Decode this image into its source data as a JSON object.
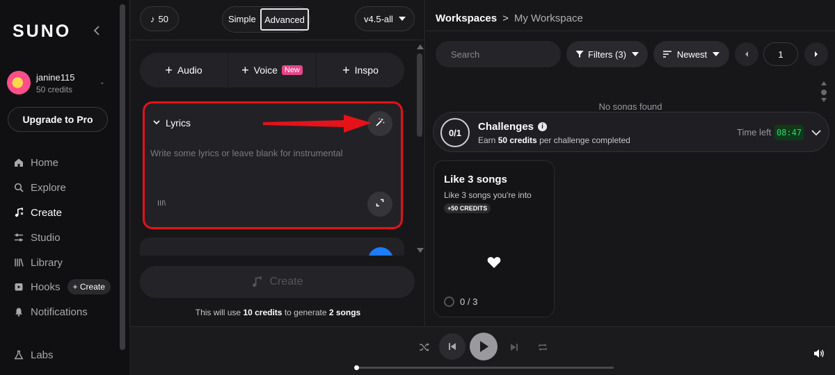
{
  "sidebar": {
    "logo": "SUNO",
    "user": {
      "name": "janine115",
      "credits": "50 credits"
    },
    "upgrade_label": "Upgrade to Pro",
    "nav": [
      {
        "label": "Home",
        "icon": "home-icon"
      },
      {
        "label": "Explore",
        "icon": "search-icon"
      },
      {
        "label": "Create",
        "icon": "music-note-icon"
      },
      {
        "label": "Studio",
        "icon": "sliders-icon"
      },
      {
        "label": "Library",
        "icon": "library-icon"
      },
      {
        "label": "Hooks",
        "icon": "hooks-icon",
        "badge": "+ Create"
      },
      {
        "label": "Notifications",
        "icon": "bell-icon"
      },
      {
        "label": "Labs",
        "icon": "flask-icon"
      }
    ]
  },
  "create": {
    "credits_pill": "50",
    "mode_simple": "Simple",
    "mode_advanced": "Advanced",
    "model": "v4.5-all",
    "tabs": [
      {
        "label": "Audio"
      },
      {
        "label": "Voice",
        "badge": "New"
      },
      {
        "label": "Inspo"
      }
    ],
    "lyrics": {
      "title": "Lyrics",
      "placeholder": "Write some lyrics or leave blank for instrumental",
      "library_glyph": "III\\"
    },
    "create_button": "Create",
    "note": {
      "prefix": "This will use ",
      "credits": "10 credits",
      "middle": " to generate ",
      "songs": "2 songs"
    }
  },
  "workspace": {
    "breadcrumb_root": "Workspaces",
    "breadcrumb_sep": ">",
    "breadcrumb_current": "My Workspace",
    "search_placeholder": "Search",
    "filters_label": "Filters (3)",
    "sort_label": "Newest",
    "page": "1",
    "empty_text": "No songs found",
    "challenges": {
      "progress": "0/1",
      "title": "Challenges",
      "subtitle_prefix": "Earn ",
      "subtitle_credits": "50 credits",
      "subtitle_suffix": " per challenge completed",
      "time_left_label": "Time left",
      "timer": "08:47"
    },
    "card": {
      "title": "Like 3 songs",
      "subtitle": "Like 3 songs you're into",
      "badge": "+50 CREDITS",
      "progress": "0 / 3"
    }
  },
  "player": {
    "controls": [
      "shuffle-icon",
      "previous-icon",
      "play-icon",
      "next-icon",
      "repeat-icon",
      "volume-icon"
    ]
  },
  "colors": {
    "annotation": "#e5121a",
    "accent_pink": "#e6458a",
    "timer_green": "#33d46a",
    "accent_blue": "#1e7bff"
  }
}
